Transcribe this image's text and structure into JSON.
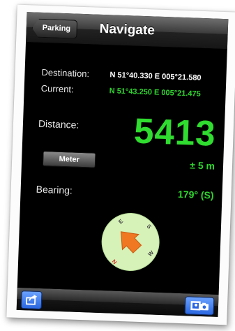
{
  "nav": {
    "back_label": "Parking",
    "title": "Navigate"
  },
  "destination": {
    "label": "Destination:",
    "value": "N 51°40.330 E 005°21.580"
  },
  "current": {
    "label": "Current:",
    "value": "N 51°43.250 E 005°21.475"
  },
  "distance": {
    "label": "Distance:",
    "value": "5413",
    "accuracy": "± 5 m"
  },
  "unit_button": {
    "label": "Meter"
  },
  "bearing": {
    "label": "Bearing:",
    "value": "179° (S)"
  },
  "compass": {
    "n": "N",
    "e": "E",
    "s": "S",
    "w": "W"
  },
  "toolbar": {
    "left_icon": "share-icon",
    "right_icon": "photo-camera-icon"
  },
  "colors": {
    "accent_green": "#2fd62f",
    "button_blue": "#2a66e0",
    "compass_face": "#d6f2b8"
  }
}
